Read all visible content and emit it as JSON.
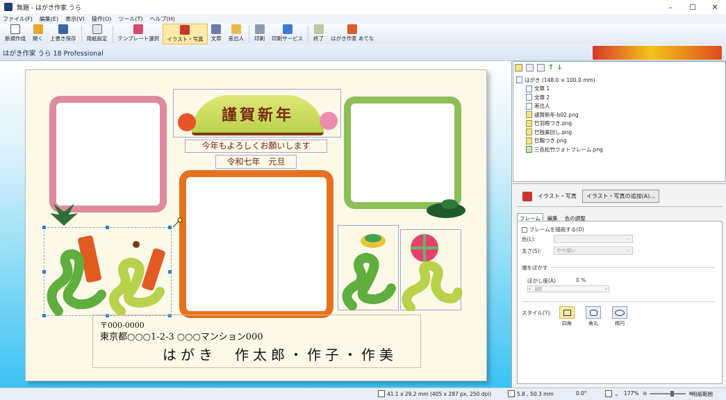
{
  "window": {
    "title": "無題 - はがき作家 うら",
    "controls": [
      "–",
      "☐",
      "✕"
    ]
  },
  "menu": [
    "ファイル(F)",
    "編集(E)",
    "表示(V)",
    "操作(O)",
    "ツール(T)",
    "ヘルプ(H)"
  ],
  "toolbar": [
    {
      "label": "新規作成",
      "icon": "new-doc-icon",
      "color": "#ffffff"
    },
    {
      "label": "開く",
      "icon": "folder-icon",
      "color": "#e8a429"
    },
    {
      "label": "上書き保存",
      "icon": "save-icon",
      "color": "#3a63a8"
    },
    {
      "label": "用紙設定",
      "icon": "paper-setup-icon",
      "color": "#dfe5ef"
    },
    {
      "label": "テンプレート選択",
      "icon": "template-icon",
      "color": "#d74a6a"
    },
    {
      "label": "イラスト・写真",
      "icon": "illustration-icon",
      "color": "#c8362f"
    },
    {
      "label": "文章",
      "icon": "text-icon",
      "color": "#6b7aa8"
    },
    {
      "label": "差出人",
      "icon": "sender-icon",
      "color": "#e7b94e"
    },
    {
      "label": "印刷",
      "icon": "print-icon",
      "color": "#8c9bb0"
    },
    {
      "label": "印刷サービス",
      "icon": "print-service-icon",
      "color": "#3a7bd0"
    },
    {
      "label": "終了",
      "icon": "exit-icon",
      "color": "#bfc8a0"
    },
    {
      "label": "はがき作家 あてな",
      "icon": "atena-icon",
      "color": "#e05a2a"
    }
  ],
  "active_tool": "イラスト・写真",
  "version_label": "はがき作家 うら 18 Professional",
  "card": {
    "greeting_title": "謹賀新年",
    "greeting_line": "今年もよろしくお願いします",
    "date_line": "令和七年　元旦",
    "address": {
      "zip": "〒000-0000",
      "line": "東京都○○○1-2-3 ○○○マンション000",
      "names": "はがき　作太郎・作子・作美"
    }
  },
  "tree": {
    "root": "はがき (148.0 × 100.0 mm)",
    "items": [
      {
        "label": "文章 1",
        "kind": "text"
      },
      {
        "label": "文章 2",
        "kind": "text"
      },
      {
        "label": "差出人",
        "kind": "text"
      },
      {
        "label": "謹賀新年-b02.png",
        "kind": "img"
      },
      {
        "label": "巳羽根つき.png",
        "kind": "img"
      },
      {
        "label": "巳独楽回し.png",
        "kind": "img"
      },
      {
        "label": "巳鞠つき.png",
        "kind": "img"
      },
      {
        "label": "三色松竹フォトフレーム.png",
        "kind": "frm"
      }
    ]
  },
  "props": {
    "header_label": "イラスト・写真",
    "add_button": "イラスト・写真の追加(A)...",
    "tabs": [
      "フレーム",
      "編集",
      "色の調整"
    ],
    "frame_checkbox": "フレームを描画する(D)",
    "color_label": "色(L):",
    "thickness_label": "太さ(S):",
    "thickness_value": "やや細い",
    "blur_section": "端をぼかす",
    "blur_label": "ぼかし度(A)",
    "blur_value": "0 %",
    "style_label": "スタイル(Y):",
    "styles": [
      "四角",
      "角丸",
      "楕円"
    ],
    "active_style": "四角"
  },
  "status": {
    "size": "41.1 x 29.2 mm (405 x 287 px, 250 dpi)",
    "position": "5.8 , 50.3 mm",
    "angle": "0.0°",
    "zoom": "177%",
    "paper_range": "用紙範囲"
  }
}
